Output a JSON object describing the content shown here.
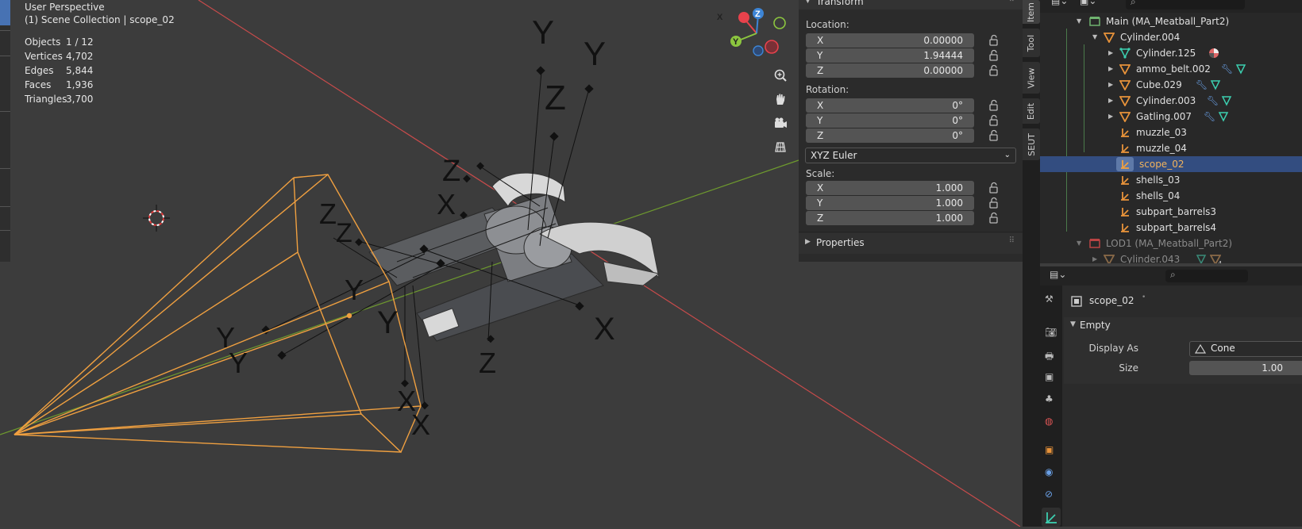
{
  "viewport": {
    "title": "User Perspective",
    "collection": "(1) Scene Collection | scope_02",
    "stats": [
      {
        "label": "Objects",
        "value": "1 / 12"
      },
      {
        "label": "Vertices",
        "value": "4,702"
      },
      {
        "label": "Edges",
        "value": "5,844"
      },
      {
        "label": "Faces",
        "value": "1,936"
      },
      {
        "label": "Triangles",
        "value": "3,700"
      }
    ],
    "gizmo": {
      "x": "X",
      "y": "Y",
      "z": "Z"
    },
    "axis_letters": {
      "x": "X",
      "y": "Y",
      "z": "Z"
    }
  },
  "transform": {
    "title": "Transform",
    "location_label": "Location:",
    "location": [
      {
        "axis": "X",
        "value": "0.00000"
      },
      {
        "axis": "Y",
        "value": "1.94444"
      },
      {
        "axis": "Z",
        "value": "0.00000"
      }
    ],
    "rotation_label": "Rotation:",
    "rotation": [
      {
        "axis": "X",
        "value": "0°"
      },
      {
        "axis": "Y",
        "value": "0°"
      },
      {
        "axis": "Z",
        "value": "0°"
      }
    ],
    "rotation_mode": "XYZ Euler",
    "scale_label": "Scale:",
    "scale": [
      {
        "axis": "X",
        "value": "1.000"
      },
      {
        "axis": "Y",
        "value": "1.000"
      },
      {
        "axis": "Z",
        "value": "1.000"
      }
    ],
    "properties_title": "Properties"
  },
  "sidetabs": [
    "Item",
    "Tool",
    "View",
    "Edit",
    "SEUT"
  ],
  "outliner": {
    "rows": [
      {
        "label": "Main (MA_Meatball_Part2)",
        "type": "collection"
      },
      {
        "label": "Cylinder.004",
        "type": "mesh"
      },
      {
        "label": "Cylinder.125",
        "type": "mesh"
      },
      {
        "label": "ammo_belt.002",
        "type": "mesh"
      },
      {
        "label": "Cube.029",
        "type": "mesh"
      },
      {
        "label": "Cylinder.003",
        "type": "mesh"
      },
      {
        "label": "Gatling.007",
        "type": "mesh"
      },
      {
        "label": "muzzle_03",
        "type": "empty"
      },
      {
        "label": "muzzle_04",
        "type": "empty"
      },
      {
        "label": "scope_02",
        "type": "empty"
      },
      {
        "label": "shells_03",
        "type": "empty"
      },
      {
        "label": "shells_04",
        "type": "empty"
      },
      {
        "label": "subpart_barrels3",
        "type": "empty"
      },
      {
        "label": "subpart_barrels4",
        "type": "empty"
      },
      {
        "label": "LOD1 (MA_Meatball_Part2)",
        "type": "collection"
      },
      {
        "label": "Cylinder.043",
        "type": "mesh"
      }
    ],
    "badge_count": "4"
  },
  "properties": {
    "object_name": "scope_02",
    "panel_title": "Empty",
    "display_as_label": "Display As",
    "display_as_value": "Cone",
    "size_label": "Size",
    "size_value": "1.00"
  },
  "colors": {
    "selection": "#334d80",
    "empty_orange": "#f0a040",
    "axis_red": "#c84b4b",
    "axis_green": "#6e9a2e",
    "gizmo_x": "#e8424c",
    "gizmo_y": "#8cc63f",
    "gizmo_z": "#3d85d6"
  }
}
